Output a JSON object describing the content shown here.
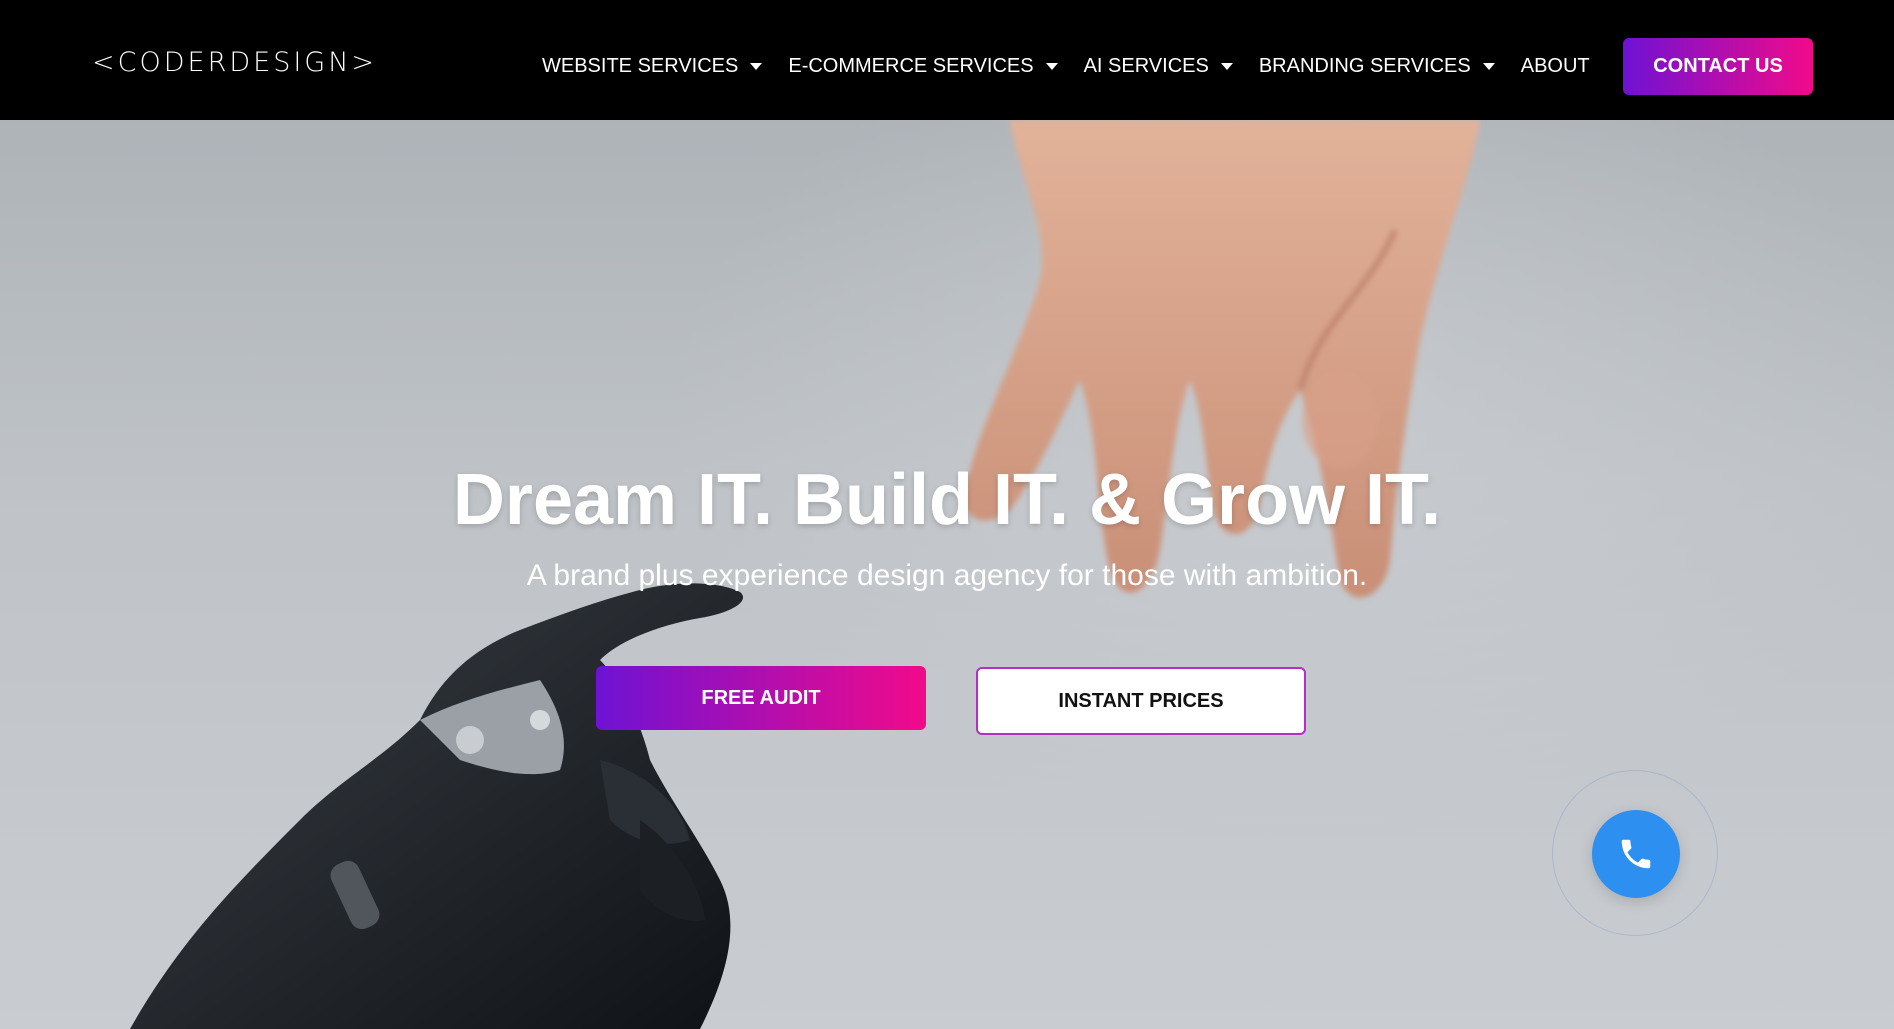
{
  "logo": {
    "text": "<CODERDESIGN>"
  },
  "nav": {
    "items": [
      {
        "label": "WEBSITE SERVICES",
        "has_dropdown": true
      },
      {
        "label": "E-COMMERCE SERVICES",
        "has_dropdown": true
      },
      {
        "label": "AI SERVICES",
        "has_dropdown": true
      },
      {
        "label": "BRANDING SERVICES",
        "has_dropdown": true
      },
      {
        "label": "ABOUT",
        "has_dropdown": false
      }
    ],
    "contact_label": "CONTACT US"
  },
  "hero": {
    "title": "Dream IT. Build IT. & Grow IT.",
    "subtitle": "A brand plus experience design agency for those with ambition.",
    "primary_button": "FREE AUDIT",
    "secondary_button": "INSTANT PRICES",
    "background_image": "human-hand-reaching-robot-hand"
  },
  "floating": {
    "call_icon": "phone-icon"
  },
  "colors": {
    "navbar_bg": "#000000",
    "gradient_start": "#6e12d4",
    "gradient_end": "#f20a8a",
    "call_button": "#2d8ff0",
    "hero_bg": "#bfc3c7"
  }
}
